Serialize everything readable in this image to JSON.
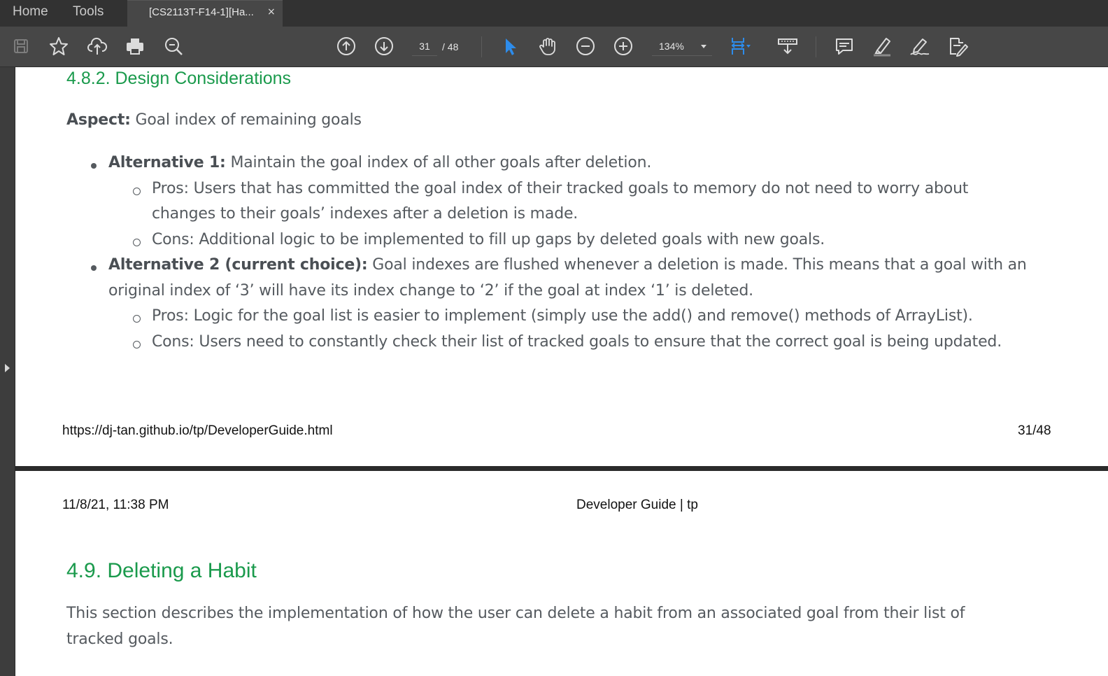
{
  "tabbar": {
    "home_label": "Home",
    "tools_label": "Tools",
    "doc_tab_title": "[CS2113T-F14-1][Ha...",
    "close_glyph": "×"
  },
  "toolbar": {
    "icons": [
      "save-icon",
      "bookmark-star-icon",
      "upload-cloud-icon",
      "print-icon",
      "zoom-search-icon",
      "page-up-icon",
      "page-down-icon",
      "select-cursor-icon",
      "hand-pan-icon",
      "zoom-out-icon",
      "zoom-in-icon",
      "fit-page-icon",
      "scroll-mode-icon",
      "comment-icon",
      "highlight-icon",
      "sign-icon",
      "edit-pdf-icon"
    ],
    "current_page": "31",
    "page_total": "/  48",
    "zoom": "134%",
    "accent_color": "#2d8ceb"
  },
  "page1": {
    "heading": "4.8.2. Design Considerations",
    "aspect_label": "Aspect:",
    "aspect_text": " Goal index of remaining goals",
    "alt1_label": "Alternative 1:",
    "alt1_text": " Maintain the goal index of all other goals after deletion.",
    "alt1_pros_line1": "Pros: Users that has committed the goal index of their tracked goals to memory do not need to worry about",
    "alt1_pros_line2": "changes to their goals’ indexes after a deletion is made.",
    "alt1_cons": "Cons: Additional logic to be implemented to fill up gaps by deleted goals with new goals.",
    "alt2_label": "Alternative 2 (current choice):",
    "alt2_text_line1": " Goal indexes are flushed whenever a deletion is made. This means that a goal with an",
    "alt2_text_line2": "original index of ‘3’ will have its index change to ‘2’ if the goal at index ‘1’ is deleted.",
    "alt2_pros": "Pros: Logic for the goal list is easier to implement (simply use the add() and remove() methods of ArrayList).",
    "alt2_cons": "Cons: Users need to constantly check their list of tracked goals to ensure that the correct goal is being updated.",
    "footer_url": "https://dj-tan.github.io/tp/DeveloperGuide.html",
    "footer_page": "31/48"
  },
  "page2": {
    "header_datetime": "11/8/21, 11:38 PM",
    "header_title": "Developer Guide | tp",
    "heading": "4.9. Deleting a Habit",
    "para_line1": "This section describes the implementation of how the user can delete a habit from an associated goal from their list of",
    "para_line2": "tracked goals."
  }
}
